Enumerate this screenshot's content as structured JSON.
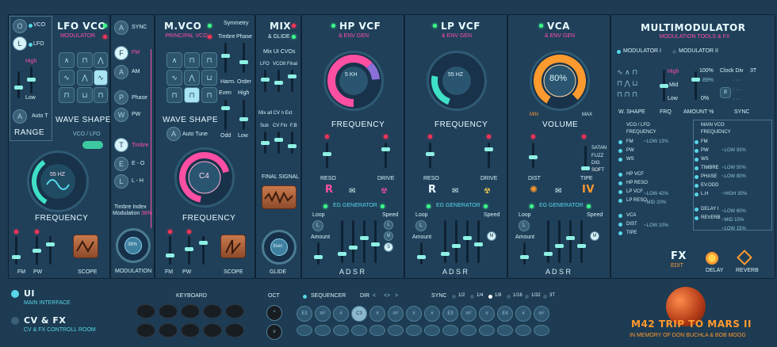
{
  "lfo": {
    "title": "LFO VCO",
    "subtitle": "MODULATOR",
    "vco": "VCO",
    "lfo": "LFO",
    "high": "High",
    "low": "Low",
    "auto": "Auto T",
    "range": "RANGE",
    "waveshape": "WAVE SHAPE",
    "vco_lfo": "VCO / LFO",
    "freq": "55 HZ",
    "frequency": "FREQUENCY",
    "fm": "FM",
    "pw": "PW",
    "scope": "SCOPE",
    "btn_o": "O",
    "btn_l": "L",
    "btn_a": "A"
  },
  "mod": {
    "sync": "SYNC",
    "fm": "FM",
    "am": "AM",
    "phase": "Phase",
    "pw": "PW",
    "timbre": "Timbre",
    "e0": "E - O",
    "lh": "L - H",
    "mod_text": "Timbre Index",
    "mod_text2": "Modulation",
    "mod_pct": "38%",
    "knob": "38%",
    "modulation": "MODULATION"
  },
  "mvco": {
    "title": "M.VCO",
    "subtitle": "PRINCIPAL VCO",
    "symmetry": "Symmetry",
    "timbre": "Timbre",
    "phase": "Phase",
    "harm": "Harm. Order",
    "even": "Even",
    "high": "High",
    "odd": "Odd",
    "low": "Low",
    "waveshape": "WAVE SHAPE",
    "auto_tune": "Auto Tune",
    "note": "C4",
    "frequency": "FREQUENCY",
    "fm": "FM",
    "pw": "PW",
    "scope": "SCOPE",
    "btn_a": "A"
  },
  "mix": {
    "title": "MIX",
    "subtitle": "& GLIDE",
    "mix_ui": "Mix UI CVOs",
    "lfo": "LFO",
    "vcoii": "VCOII",
    "final": "Final",
    "mix_cv": "Mix all CV n Ext",
    "sub": "Sub",
    "cvfm": "CV Fin",
    "fb": "F.B",
    "final_signal": "FINAL SIGNAL",
    "glide_knob": "3sec",
    "glide": "GLIDE"
  },
  "hpvcf": {
    "title": "HP VCF",
    "subtitle": "& ENV GEN",
    "freq": "5 KH",
    "frequency": "FREQUENCY",
    "reso": "RESO",
    "drive": "DRIVE",
    "r": "R",
    "eg": "EG GENERATOR",
    "loop": "Loop",
    "amount": "Amount",
    "speed": "Speed",
    "adsr": "A  D  S  R",
    "btn_l": "L",
    "btn_m": "M",
    "btn_s": "S"
  },
  "lpvcf": {
    "title": "LP VCF",
    "subtitle": "& ENV GEN",
    "freq": "55 HZ",
    "frequency": "FREQUENCY",
    "reso": "RESO",
    "drive": "DRIVE",
    "r": "R",
    "eg": "EG GENERATOR",
    "loop": "Loop",
    "amount": "Amount",
    "speed": "Speed",
    "adsr": "A  D  S  R",
    "btn_l": "L",
    "btn_m": "M"
  },
  "vca": {
    "title": "VCA",
    "subtitle": "& ENV GEN",
    "level": "80%",
    "min": "MIN",
    "max": "MAX",
    "volume": "VOLUME",
    "satan": "SATAN",
    "fuzz": "FUZZ",
    "dig": "DIG",
    "soft": "SOFT",
    "dist": "DIST",
    "tipe": "TIPE",
    "iv": "IV",
    "eg": "EG GENERATOR",
    "loop": "Loop",
    "amount": "Amount",
    "speed": "Speed",
    "adsr": "A  D  S  R",
    "btn_l": "L",
    "btn_m": "M"
  },
  "mm": {
    "title": "MULTIMODULATOR",
    "subtitle": "MODULATION TOOLS & FX",
    "mod1": "MODULATOR I",
    "mod2": "MODULATOR II",
    "high": "High",
    "mid": "Mid",
    "low": "Low",
    "pct100": "100%",
    "pct89": "89%",
    "pct0": "0%",
    "clock": "Clock Div",
    "t3": "3T",
    "n8": "8",
    "wshape": "W. SHAPE",
    "frq": "FRQ",
    "amount": "AMOUNT %",
    "sync": "SYNC",
    "left_head": "VCO / LFO",
    "left_head2": "FREQUENCY",
    "left": [
      "FM",
      "PW",
      "WS",
      "HP VCF",
      "HP RESO",
      "LP VCF",
      "LP RESO",
      "VCA",
      "DIST",
      "TIPE"
    ],
    "right_head": "MAIN VCO",
    "right_head2": "FREQUENCY",
    "right": [
      "FM",
      "PW",
      "WS",
      "TIMBRE",
      "PHASE",
      "EV.ODD",
      "L.H",
      "DELAY I",
      "REVERB"
    ],
    "tags": [
      {
        "t": "LOW 13%"
      },
      {
        "t": "LOW 93%"
      },
      {
        "t": "LOW 50%"
      },
      {
        "t": "LOW 80%"
      },
      {
        "t": "HIGH 35%"
      },
      {
        "t": "LOW 42%"
      },
      {
        "t": "MID 20%"
      },
      {
        "t": "LOW 10%"
      },
      {
        "t": "MID 15%"
      },
      {
        "t": "LOW 15%"
      },
      {
        "t": "LOW 60%"
      }
    ],
    "fx": "FX",
    "edit": "EDIT",
    "delay": "DELAY",
    "reverb": "REVERB"
  },
  "bottom": {
    "ui": "UI",
    "ui_sub": "MAIN INTERFACE",
    "cvfx": "CV & FX",
    "cvfx_sub": "CV & FX CONTROLL ROOM",
    "keyboard": "KEYBOARD",
    "oct": "OCT",
    "oct_up": "^",
    "oct_dn": "v",
    "sequencer": "SEQUENCER",
    "dir": "DIR",
    "dirs": [
      "<",
      "<>",
      ">"
    ],
    "sync": "SYNC",
    "divs": [
      "1/2",
      "1/4",
      "1/8",
      "1/16",
      "1/32",
      "3T"
    ],
    "seq": [
      "E3",
      "m²",
      "#",
      "C3",
      "#",
      "m²",
      "#",
      "#",
      "E3",
      "m²",
      "#",
      "E4",
      "#",
      "m²"
    ],
    "brand": "M42 TRIP TO MARS II",
    "memory": "IN MEMORY OF DON BUCHLA & BOB MOOG"
  },
  "colors": {
    "bg": "#1d3b52",
    "panel": "#20405a",
    "pink": "#ff4fa3",
    "cyan": "#57d7e8",
    "orange": "#ff9a2e",
    "mint": "#8ef0e4"
  }
}
